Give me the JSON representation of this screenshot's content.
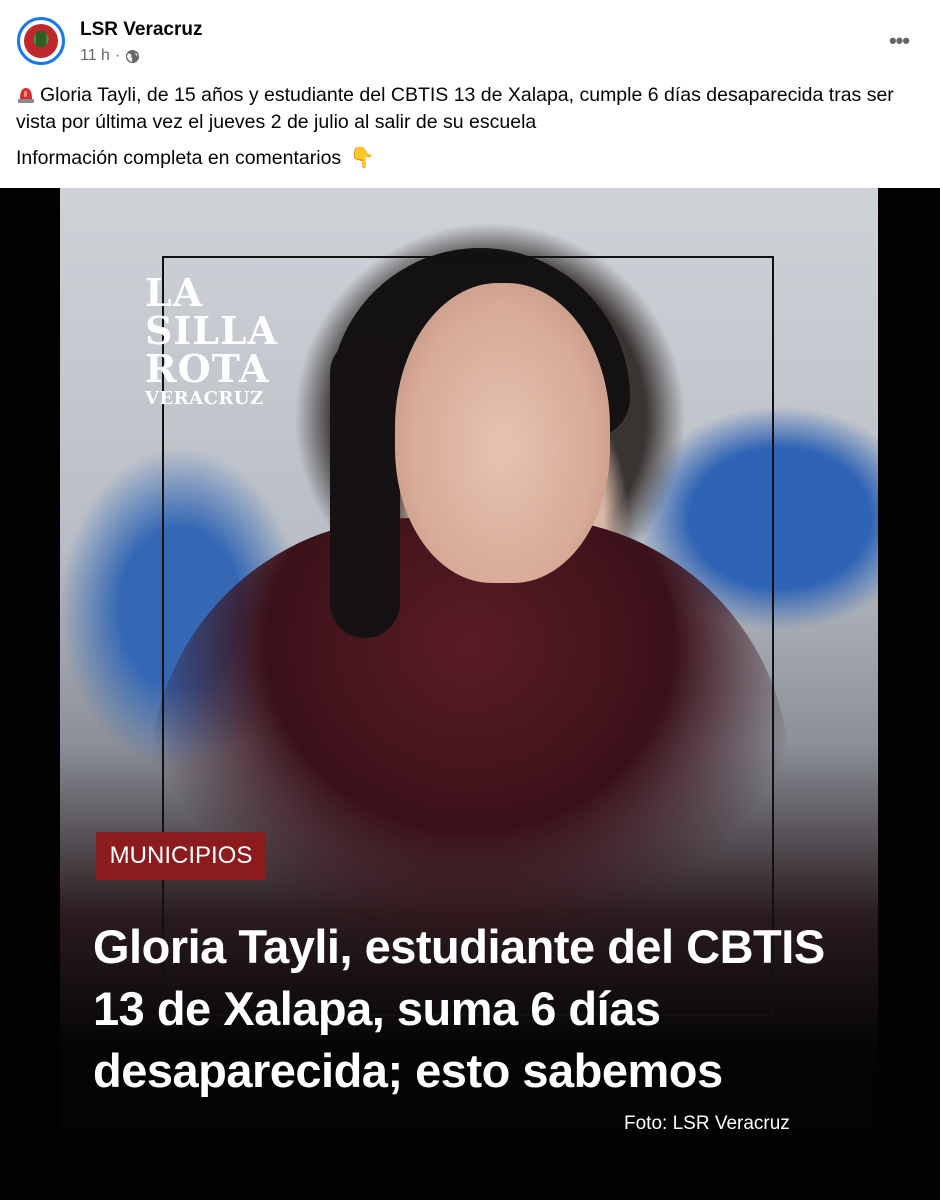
{
  "post": {
    "page_name": "LSR Veracruz",
    "time": "11 h",
    "privacy_icon": "globe-icon",
    "more_icon": "more-options-icon",
    "caption_line1": "Gloria Tayli, de 15 años y estudiante del CBTIS 13 de Xalapa, cumple 6 días desaparecida tras ser vista por última vez el jueves 2 de julio al salir de su escuela",
    "caption_line2": "Información completa en comentarios",
    "caption_icon1": "siren-emoji",
    "caption_icon2": "pointing-down-emoji",
    "caption_icon2_glyph": "👇"
  },
  "image": {
    "logo_line1": "LA",
    "logo_line2": "SILLA",
    "logo_line3": "ROTA",
    "logo_line4": "VERACRUZ",
    "badge": "MUNICIPIOS",
    "headline": "Gloria Tayli, estudiante del CBTIS 13 de Xalapa, suma 6 días desaparecida; esto sabemos",
    "credit": "Foto: LSR Veracruz",
    "colors": {
      "badge": "#8c1b1d",
      "background": "#020202"
    }
  }
}
